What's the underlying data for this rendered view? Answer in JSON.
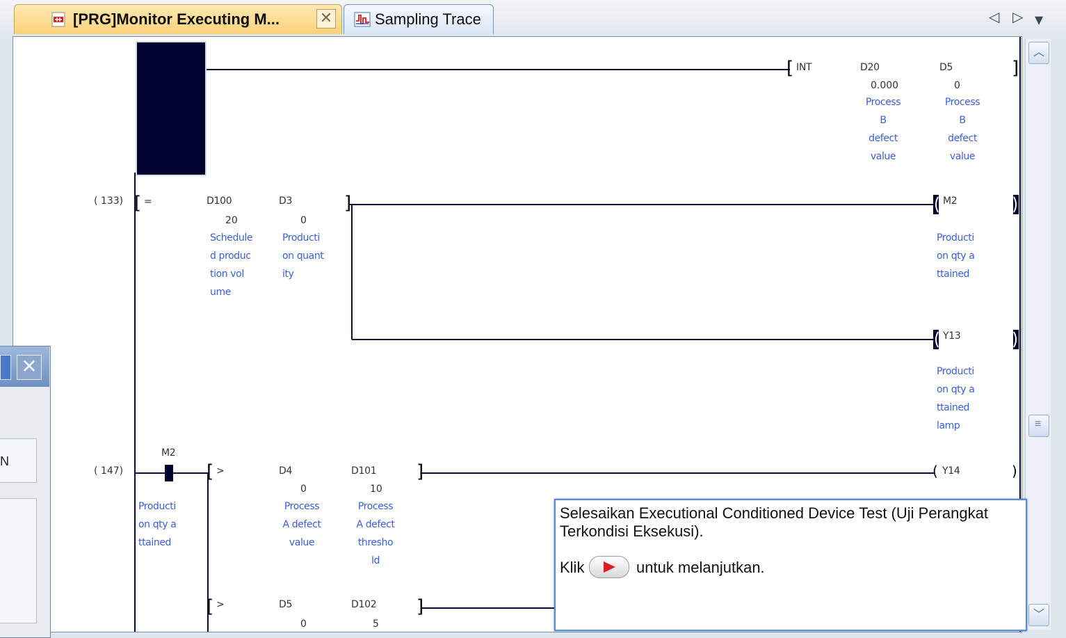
{
  "tabs": [
    {
      "label": "[PRG]Monitor Executing M...",
      "icon": "ladder-program-icon",
      "close": "✕"
    },
    {
      "label": "Sampling Trace",
      "icon": "sampling-trace-icon"
    }
  ],
  "tab_nav": {
    "prev": "◁",
    "next": "▷",
    "menu": "▾"
  },
  "scroll": {
    "up": "︿",
    "down": "﹀",
    "thumb": "≡"
  },
  "rungs": {
    "r1": {
      "instr_bracket_open": "[",
      "instruction": "INT",
      "op1": "D20",
      "op1_value": "0.000",
      "op1_comment": [
        "Process",
        "B defect",
        "value"
      ],
      "op2": "D5",
      "op2_value": "0",
      "op2_comment": [
        "Process",
        "B defect",
        "value"
      ],
      "bracket_close": "]"
    },
    "r2": {
      "step": "(    133)",
      "compare_open": "[",
      "compare_op": "=",
      "op1": "D100",
      "op1_value": "20",
      "op1_comment": [
        "Schedule",
        "d produc",
        "tion vol",
        "ume"
      ],
      "op2": "D3",
      "op2_value": "0",
      "op2_comment": [
        "Producti",
        "on quant",
        "ity"
      ],
      "compare_close": "]",
      "coil1": "M2",
      "coil1_comment": [
        "Producti",
        "on qty a",
        "ttained"
      ],
      "coil2": "Y13",
      "coil2_comment": [
        "Producti",
        "on qty a",
        "ttained",
        "lamp"
      ]
    },
    "r3": {
      "step": "(    147)",
      "contact": "M2",
      "contact_comment": [
        "Producti",
        "on qty a",
        "ttained"
      ],
      "cmp1_open": "[",
      "cmp1_op": ">",
      "cmp1_op1": "D4",
      "cmp1_op1_value": "0",
      "cmp1_op1_comment": [
        "Process",
        "A defect",
        "value"
      ],
      "cmp1_op2": "D101",
      "cmp1_op2_value": "10",
      "cmp1_op2_comment": [
        "Process",
        "A defect",
        "thresho",
        "ld"
      ],
      "cmp1_close": "]",
      "coil": "Y14",
      "cmp2_open": "[",
      "cmp2_op": ">",
      "cmp2_op1": "D5",
      "cmp2_op1_value": "0",
      "cmp2_op2": "D102",
      "cmp2_op2_value": "5",
      "cmp2_close": "]"
    }
  },
  "left_panel": {
    "close": "✕",
    "text": "N"
  },
  "tooltip": {
    "line1": "Selesaikan Executional Conditioned Device Test (Uji Perangkat",
    "line2": "Terkondisi Eksekusi).",
    "klik": "Klik",
    "continue_text": "untuk melanjutkan."
  },
  "colors": {
    "comment": "#3a5fd8",
    "ladder_line": "#0c0c3a",
    "active_tab": "#fbd27a",
    "tooltip_border": "#5b8ad8"
  }
}
